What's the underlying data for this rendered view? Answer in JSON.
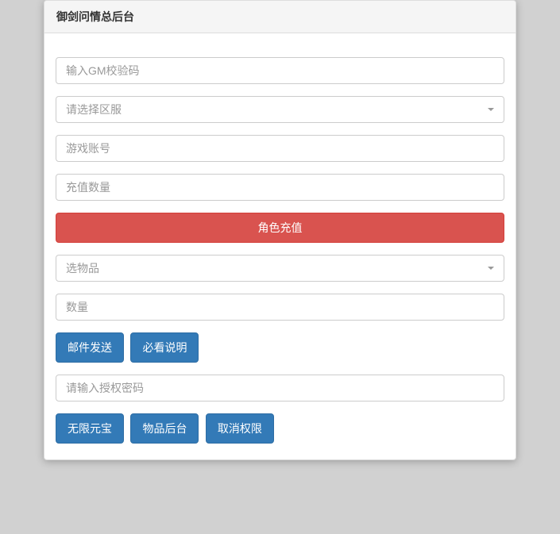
{
  "panel": {
    "title": "御剑问情总后台"
  },
  "inputs": {
    "gm_code_placeholder": "输入GM校验码",
    "server_select": "请选择区服",
    "game_account_placeholder": "游戏账号",
    "recharge_amount_placeholder": "充值数量",
    "item_select": "选物品",
    "quantity_placeholder": "数量",
    "auth_password_placeholder": "请输入授权密码"
  },
  "buttons": {
    "role_recharge": "角色充值",
    "mail_send": "邮件发送",
    "must_read": "必看说明",
    "unlimited_gold": "无限元宝",
    "item_backend": "物品后台",
    "cancel_auth": "取消权限"
  }
}
